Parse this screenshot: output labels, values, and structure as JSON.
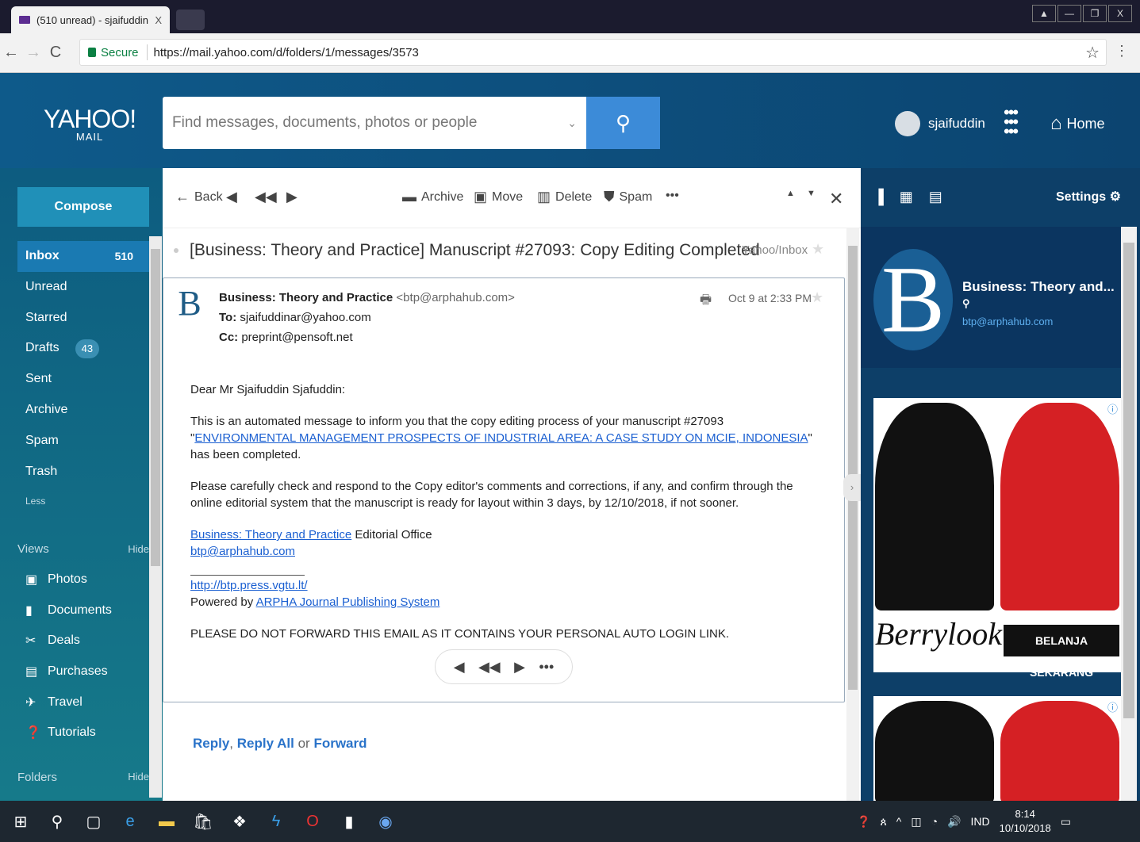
{
  "browser": {
    "tab_title": "(510 unread) - sjaifuddin",
    "tab_close": "X",
    "secure_label": "Secure",
    "url": "https://mail.yahoo.com/d/folders/1/messages/3573"
  },
  "header": {
    "logo": "YAHOO!",
    "logo_sub": "MAIL",
    "search_placeholder": "Find messages, documents, photos or people",
    "username": "sjaifuddin",
    "home_label": "Home"
  },
  "sidebar": {
    "compose_label": "Compose",
    "items": [
      {
        "label": "Inbox",
        "count": "510"
      },
      {
        "label": "Unread",
        "count": ""
      },
      {
        "label": "Starred",
        "count": ""
      },
      {
        "label": "Drafts",
        "count": "43"
      },
      {
        "label": "Sent",
        "count": ""
      },
      {
        "label": "Archive",
        "count": ""
      },
      {
        "label": "Spam",
        "count": ""
      },
      {
        "label": "Trash",
        "count": ""
      },
      {
        "label": "Less",
        "count": ""
      }
    ],
    "views_label": "Views",
    "hide_label": "Hide",
    "views": [
      {
        "label": "Photos",
        "icon": "photo-icon"
      },
      {
        "label": "Documents",
        "icon": "document-icon"
      },
      {
        "label": "Deals",
        "icon": "scissors-icon"
      },
      {
        "label": "Purchases",
        "icon": "receipt-icon"
      },
      {
        "label": "Travel",
        "icon": "plane-icon"
      },
      {
        "label": "Tutorials",
        "icon": "question-icon"
      }
    ],
    "folders_label": "Folders",
    "folders_hide": "Hide"
  },
  "toolbar": {
    "back": "Back",
    "archive": "Archive",
    "move": "Move",
    "delete": "Delete",
    "spam": "Spam",
    "more": "•••"
  },
  "message": {
    "subject": "[Business: Theory and Practice] Manuscript #27093: Copy Editing Completed",
    "folder": "Yahoo/Inbox",
    "from_name": "Business: Theory and Practice",
    "from_addr": "<btp@arphahub.com>",
    "to_label": "To:",
    "to": "sjaifuddinar@yahoo.com",
    "cc_label": "Cc:",
    "cc": "preprint@pensoft.net",
    "date": "Oct 9 at 2:33 PM",
    "greeting": "Dear Mr Sjaifuddin Sjafuddin:",
    "p1_before": "This is an automated message to inform you that the copy editing process of your manuscript #27093 \"",
    "p1_link": "ENVIRONMENTAL MANAGEMENT PROSPECTS OF INDUSTRIAL AREA: A CASE STUDY ON MCIE, INDONESIA",
    "p1_after": "\" has been completed.",
    "p2": "Please carefully check and respond to the Copy editor's comments and corrections, if any, and confirm through the online editorial system that the manuscript is ready for layout within 3 days, by 12/10/2018, if not sooner.",
    "sig_link": "Business: Theory and Practice",
    "sig_after": " Editorial Office",
    "sig_email": "btp@arphahub.com",
    "site_link": "http://btp.press.vgtu.lt/",
    "powered_by": "Powered by ",
    "powered_link": "ARPHA Journal Publishing System",
    "warning": "PLEASE DO NOT FORWARD THIS EMAIL AS IT CONTAINS YOUR PERSONAL AUTO LOGIN LINK.",
    "reply": "Reply",
    "reply_all": "Reply All",
    "or": "or",
    "forward": "Forward"
  },
  "right_panel": {
    "settings_label": "Settings",
    "contact_name": "Business: Theory and...",
    "contact_email": "btp@arphahub.com",
    "ad_brand": "Berrylook",
    "ad_cta": "BELANJA SEKARANG"
  },
  "taskbar": {
    "lang": "IND",
    "time": "8:14",
    "date": "10/10/2018"
  }
}
